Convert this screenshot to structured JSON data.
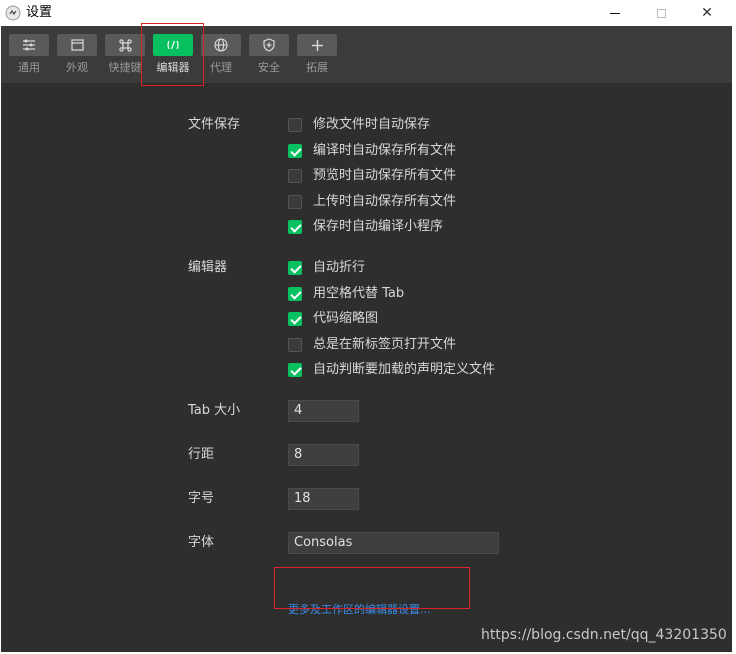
{
  "window": {
    "title": "设置",
    "controls": {
      "minimize": "minimize",
      "maximize": "maximize",
      "close": "✕"
    }
  },
  "toolbar": {
    "tabs": [
      {
        "label": "通用",
        "icon": "list-settings-icon",
        "active": false
      },
      {
        "label": "外观",
        "icon": "window-layout-icon",
        "active": false
      },
      {
        "label": "快捷键",
        "icon": "command-key-icon",
        "active": false
      },
      {
        "label": "编辑器",
        "icon": "code-icon",
        "active": true
      },
      {
        "label": "代理",
        "icon": "globe-icon",
        "active": false
      },
      {
        "label": "安全",
        "icon": "shield-icon",
        "active": false
      },
      {
        "label": "拓展",
        "icon": "plus-icon",
        "active": false
      }
    ]
  },
  "file_save": {
    "label": "文件保存",
    "options": [
      {
        "label": "修改文件时自动保存",
        "checked": false
      },
      {
        "label": "编译时自动保存所有文件",
        "checked": true
      },
      {
        "label": "预览时自动保存所有文件",
        "checked": false
      },
      {
        "label": "上传时自动保存所有文件",
        "checked": false
      },
      {
        "label": "保存时自动编译小程序",
        "checked": true
      }
    ]
  },
  "editor": {
    "label": "编辑器",
    "options": [
      {
        "label": "自动折行",
        "checked": true
      },
      {
        "label": "用空格代替 Tab",
        "checked": true
      },
      {
        "label": "代码缩略图",
        "checked": true
      },
      {
        "label": "总是在新标签页打开文件",
        "checked": false
      },
      {
        "label": "自动判断要加载的声明定义文件",
        "checked": true
      }
    ]
  },
  "fields": {
    "tab_size": {
      "label": "Tab 大小",
      "value": "4"
    },
    "line_height": {
      "label": "行距",
      "value": "8"
    },
    "font_size": {
      "label": "字号",
      "value": "18"
    },
    "font_family": {
      "label": "字体",
      "value": "Consolas"
    }
  },
  "more_settings_link": "更多及工作区的编辑器设置...",
  "watermark": "https://blog.csdn.net/qq_43201350",
  "colors": {
    "accent": "#07c160",
    "link": "#3a8eea",
    "highlight_box": "#d9232b",
    "background": "#2e2e2e",
    "toolbar": "#3b3b3b"
  }
}
